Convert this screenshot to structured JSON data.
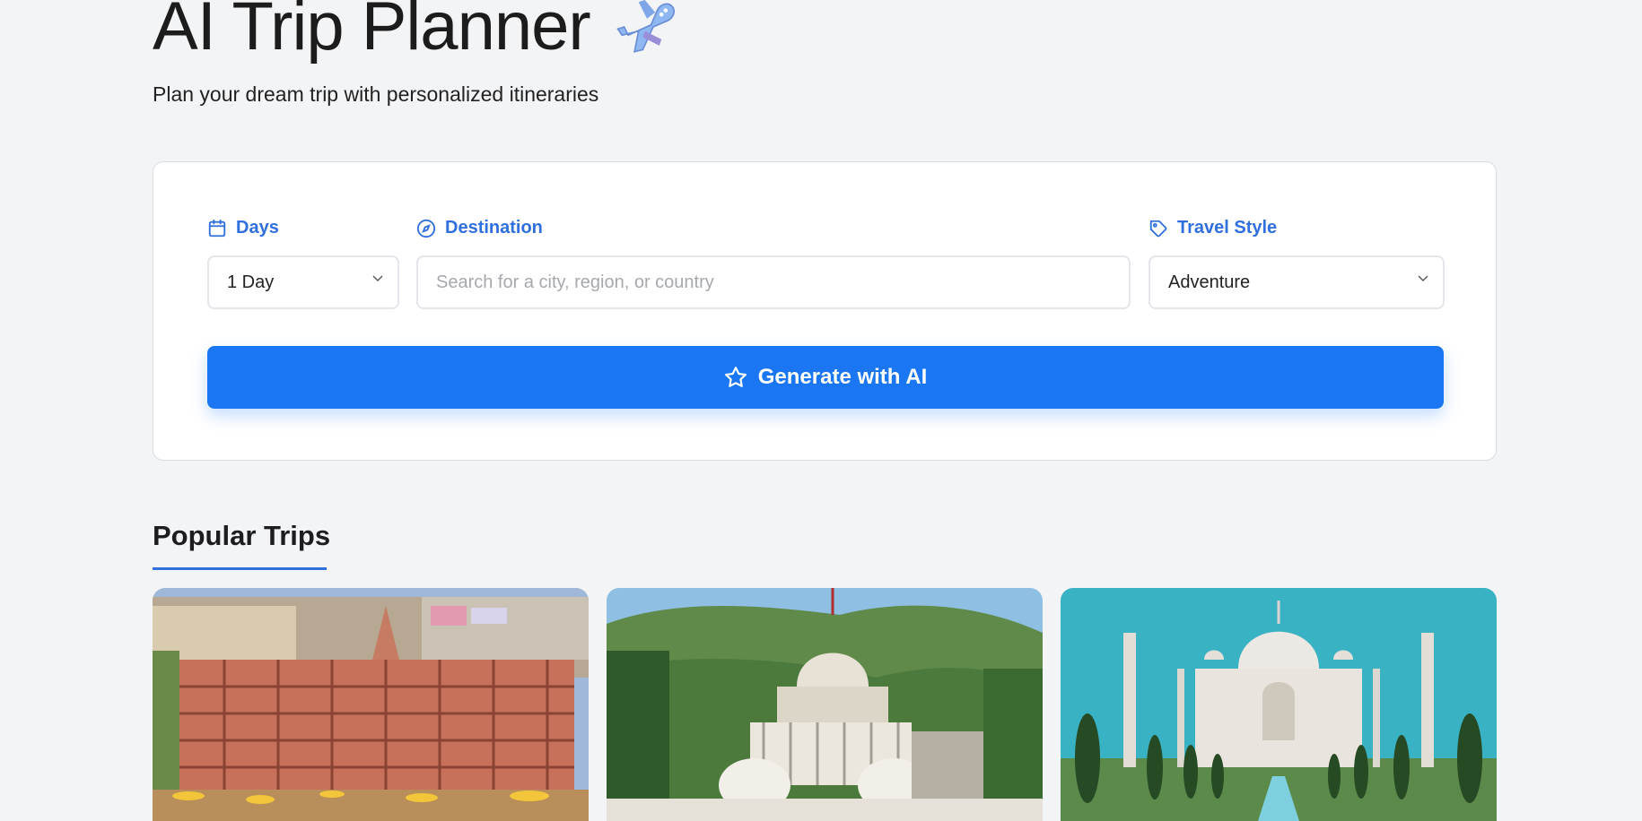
{
  "header": {
    "title": "AI Trip Planner",
    "subtitle": "Plan your dream trip with personalized itineraries",
    "title_icon": "airplane-icon"
  },
  "form": {
    "days": {
      "label": "Days",
      "icon": "calendar-icon",
      "value": "1 Day"
    },
    "destination": {
      "label": "Destination",
      "icon": "compass-icon",
      "placeholder": "Search for a city, region, or country"
    },
    "travel_style": {
      "label": "Travel Style",
      "icon": "tag-icon",
      "value": "Adventure"
    },
    "generate_label": "Generate with AI"
  },
  "popular": {
    "title": "Popular Trips",
    "trips": [
      {
        "image": "riverside-temple-town-photo"
      },
      {
        "image": "hilltop-jain-temple-photo"
      },
      {
        "image": "taj-mahal-photo"
      }
    ]
  },
  "colors": {
    "accent": "#1a76f2",
    "label": "#2f6fde",
    "background": "#f3f4f6"
  }
}
